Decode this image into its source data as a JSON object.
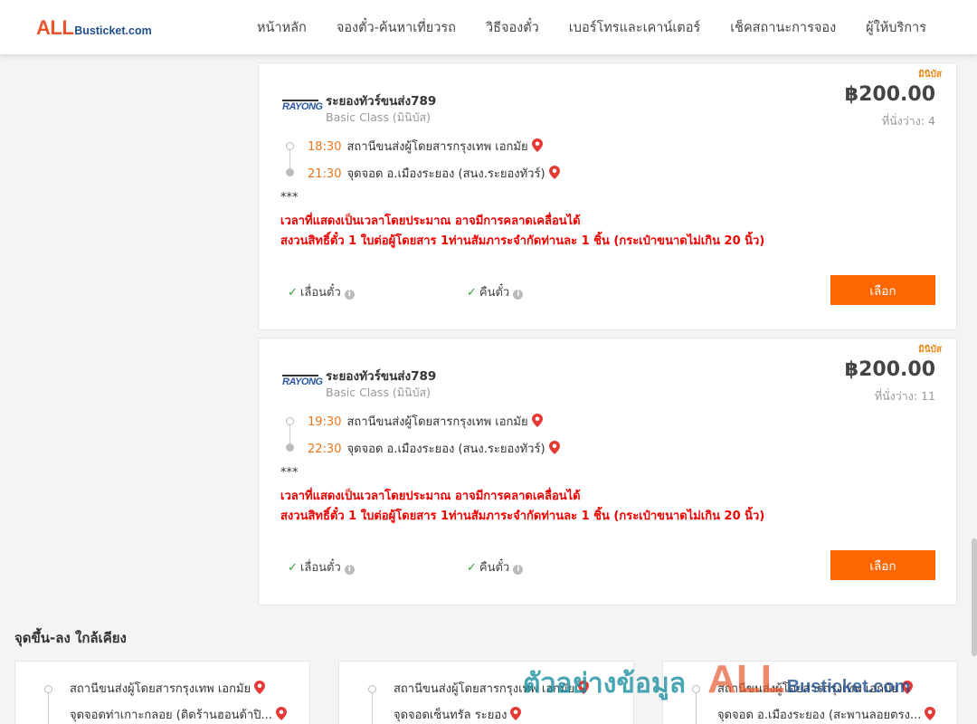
{
  "header": {
    "logo_all": "ALL",
    "logo_rest": "Busticket.com",
    "nav": [
      {
        "label": "หน้าหลัก"
      },
      {
        "label": "จองตั๋ว-ค้นหาเที่ยวรถ"
      },
      {
        "label": "วิธีจองตั๋ว"
      },
      {
        "label": "เบอร์โทรและเคาน์เตอร์"
      },
      {
        "label": "เช็คสถานะการจอง"
      },
      {
        "label": "ผู้ให้บริการ"
      }
    ]
  },
  "trips": [
    {
      "bus_type": "มินิบัส",
      "operator_logo": "RAYONG",
      "operator": "ระยองทัวร์ขนส่ง789",
      "bus_class": "Basic Class (มินิบัส)",
      "price": "฿200.00",
      "seats_label": "ที่นั่งว่าง: 4",
      "depart_time": "18:30",
      "depart_place": "สถานีขนส่งผู้โดยสารกรุงเทพ เอกมัย",
      "arrive_time": "21:30",
      "arrive_place": "จุดจอด อ.เมืองระยอง (สนง.ระยองทัวร์)",
      "note_stars": "***",
      "note_line1": "เวลาที่แสดงเป็นเวลาโดยประมาณ อาจมีการคลาดเคลื่อนได้",
      "note_line2": "สงวนสิทธิ์ตั๋ว 1 ใบต่อผู้โดยสาร 1ท่านสัมภาระจำกัดท่านละ 1 ชิ้น (กระเป๋าขนาดไม่เกิน 20 นิ้ว)",
      "feature1": "เลื่อนตั๋ว",
      "feature2": "คืนตั๋ว",
      "select_label": "เลือก"
    },
    {
      "bus_type": "มินิบัส",
      "operator_logo": "RAYONG",
      "operator": "ระยองทัวร์ขนส่ง789",
      "bus_class": "Basic Class (มินิบัส)",
      "price": "฿200.00",
      "seats_label": "ที่นั่งว่าง: 11",
      "depart_time": "19:30",
      "depart_place": "สถานีขนส่งผู้โดยสารกรุงเทพ เอกมัย",
      "arrive_time": "22:30",
      "arrive_place": "จุดจอด อ.เมืองระยอง (สนง.ระยองทัวร์)",
      "note_stars": "***",
      "note_line1": "เวลาที่แสดงเป็นเวลาโดยประมาณ อาจมีการคลาดเคลื่อนได้",
      "note_line2": "สงวนสิทธิ์ตั๋ว 1 ใบต่อผู้โดยสาร 1ท่านสัมภาระจำกัดท่านละ 1 ชิ้น (กระเป๋าขนาดไม่เกิน 20 นิ้ว)",
      "feature1": "เลื่อนตั๋ว",
      "feature2": "คืนตั๋ว",
      "select_label": "เลือก"
    }
  ],
  "nearby": {
    "title": "จุดขึ้น-ลง ใกล้เคียง",
    "items": [
      {
        "from": "สถานีขนส่งผู้โดยสารกรุงเทพ เอกมัย",
        "to": "จุดจอดท่าเกาะกลอย (ติดร้านฮอนด้าปิ..."
      },
      {
        "from": "สถานีขนส่งผู้โดยสารกรุงเทพ เอกมัย",
        "to": "จุดจอดเซ็นทรัล ระยอง"
      },
      {
        "from": "สถานีขนส่งผู้โดยสารกรุงเทพ เอกมัย",
        "to": "จุดจอด อ.เมืองระยอง (สะพานลอยตรง..."
      }
    ]
  },
  "watermark": {
    "thai": "ตัวอย่างข้อมูล",
    "all": "ALL",
    "rest": "Busticket.com"
  },
  "colors": {
    "accent": "#fe6600",
    "time": "#e8751a",
    "warning": "#ee0000",
    "check": "#2aa13a"
  }
}
